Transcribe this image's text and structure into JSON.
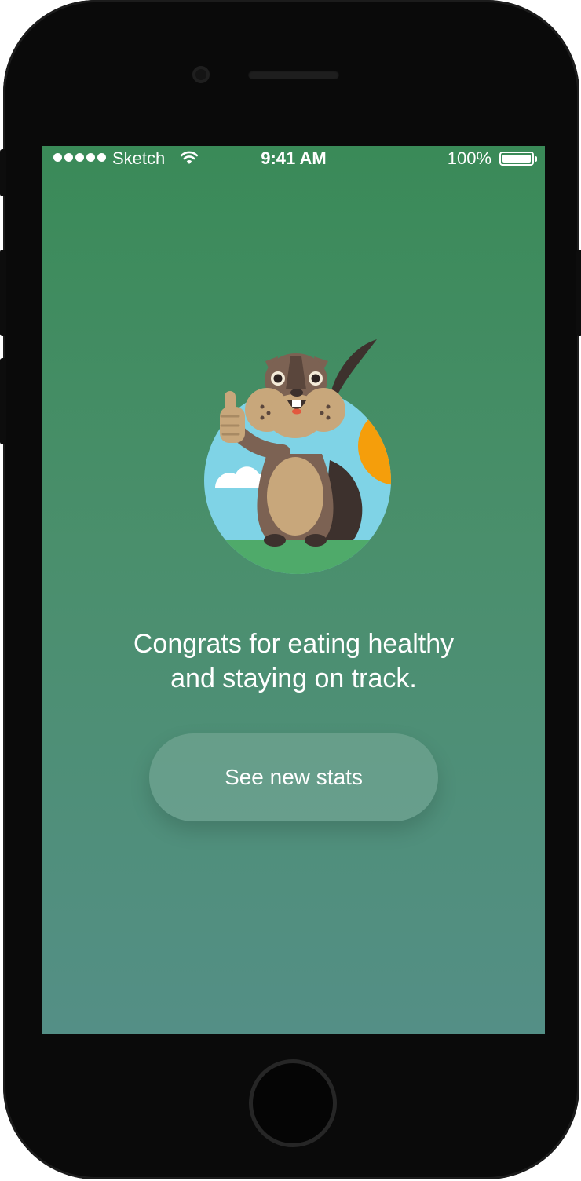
{
  "status_bar": {
    "carrier": "Sketch",
    "time": "9:41 AM",
    "battery_percent": "100%",
    "signal_bars": 5,
    "battery_level": 1.0
  },
  "main": {
    "message_line1": "Congrats for eating healthy",
    "message_line2": "and staying on track.",
    "cta_label": "See new stats"
  },
  "colors": {
    "gradient_top": "#3a8a58",
    "gradient_bottom": "#548f86",
    "sky": "#7fd3e6",
    "grass": "#4faa6a",
    "sun": "#f59e0b"
  },
  "icons": [
    "signal-icon",
    "wifi-icon",
    "battery-icon",
    "mascot-illustration"
  ]
}
